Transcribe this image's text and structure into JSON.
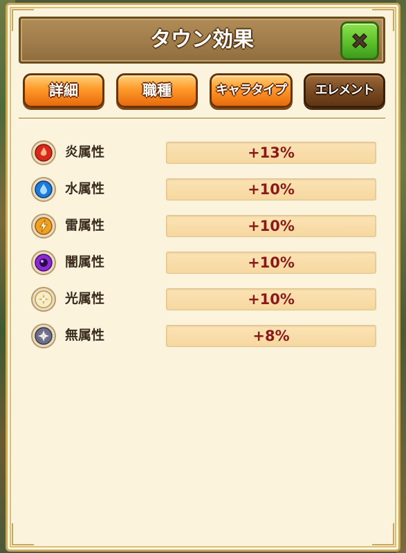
{
  "window": {
    "title": "タウン効果"
  },
  "tabs": [
    {
      "label": "詳細",
      "active": false
    },
    {
      "label": "職種",
      "active": false
    },
    {
      "label": "キャラタイプ",
      "active": false
    },
    {
      "label": "エレメント",
      "active": true
    }
  ],
  "elements": [
    {
      "name": "炎属性",
      "value": "+13%",
      "icon": "fire-icon",
      "color": "#d8281a"
    },
    {
      "name": "水属性",
      "value": "+10%",
      "icon": "water-icon",
      "color": "#1e7ad8"
    },
    {
      "name": "雷属性",
      "value": "+10%",
      "icon": "thunder-icon",
      "color": "#f0a020"
    },
    {
      "name": "闇属性",
      "value": "+10%",
      "icon": "dark-icon",
      "color": "#8a2ad0"
    },
    {
      "name": "光属性",
      "value": "+10%",
      "icon": "light-icon",
      "color": "#f2e2b0"
    },
    {
      "name": "無属性",
      "value": "+8%",
      "icon": "neutral-icon",
      "color": "#8a8aa0"
    }
  ],
  "colors": {
    "panel_bg": "#fbf3dc",
    "value_text": "#8a1a1a",
    "tab_orange": "#ff9a2a",
    "tab_active_brown": "#7a4a22",
    "close_green": "#5cc12c"
  }
}
